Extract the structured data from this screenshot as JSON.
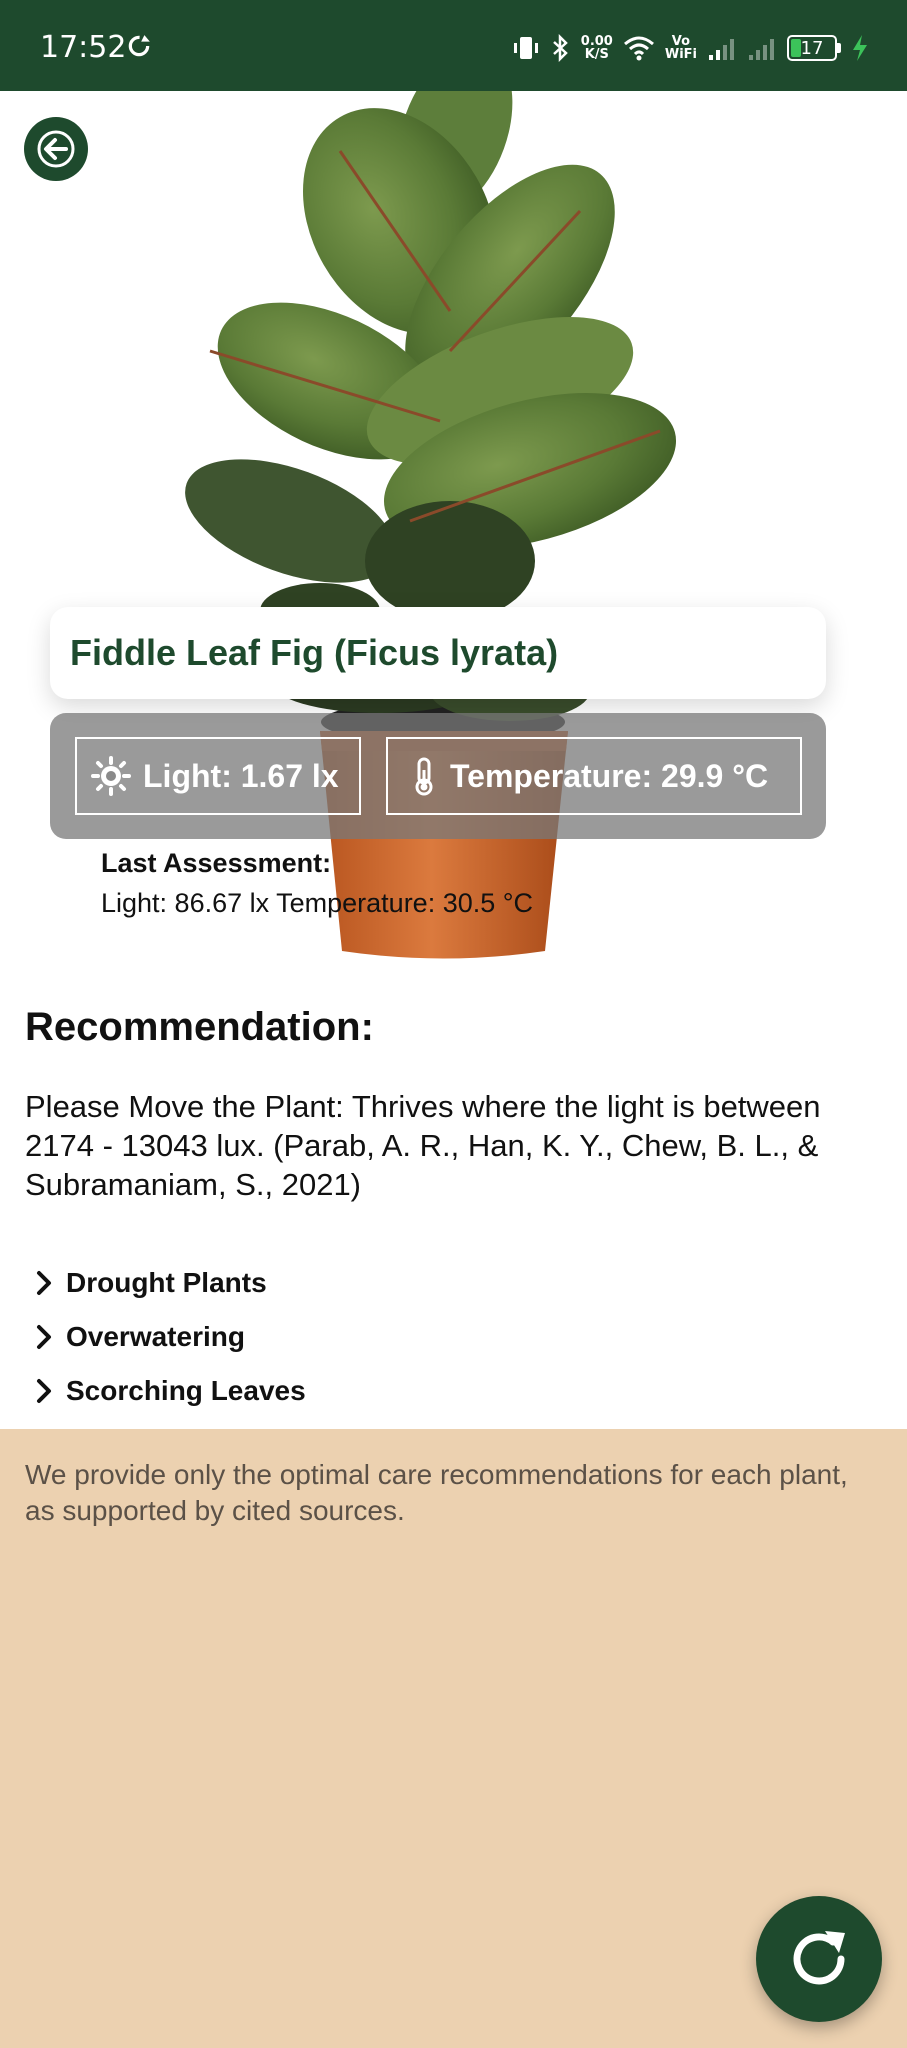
{
  "status_bar": {
    "time": "17:52",
    "net_speed_value": "0.00",
    "net_speed_unit": "K/S",
    "vowifi_top": "Vo",
    "vowifi_bottom": "WiFi",
    "battery_level": "17",
    "icons": [
      "sync-icon",
      "vibrate-icon",
      "bluetooth-icon",
      "wifi-icon",
      "signal-icon",
      "signal-icon",
      "battery-icon",
      "charging-icon"
    ]
  },
  "plant": {
    "name": "Fiddle Leaf Fig (Ficus lyrata)",
    "image_icon": "plant-photo"
  },
  "readings": {
    "light_label": "Light: 1.67 lx",
    "temperature_label": "Temperature: 29.9 °C"
  },
  "last_assessment": {
    "title": "Last Assessment:",
    "values": "Light: 86.67 lx Temperature: 30.5 °C"
  },
  "recommendation": {
    "heading": "Recommendation:",
    "text": "Please Move the Plant: Thrives where the light is between 2174 - 13043 lux. (Parab, A. R., Han, K. Y., Chew, B. L., & Subramaniam, S., 2021)"
  },
  "care_items": [
    {
      "label": "Drought Plants"
    },
    {
      "label": "Overwatering"
    },
    {
      "label": "Scorching Leaves"
    }
  ],
  "footer": {
    "note": "We provide only the optimal care recommendations for each plant, as supported by cited sources."
  },
  "colors": {
    "primary": "#1e4a2d",
    "footer_bg": "#ecd1b0",
    "panel_bg": "#787878"
  }
}
